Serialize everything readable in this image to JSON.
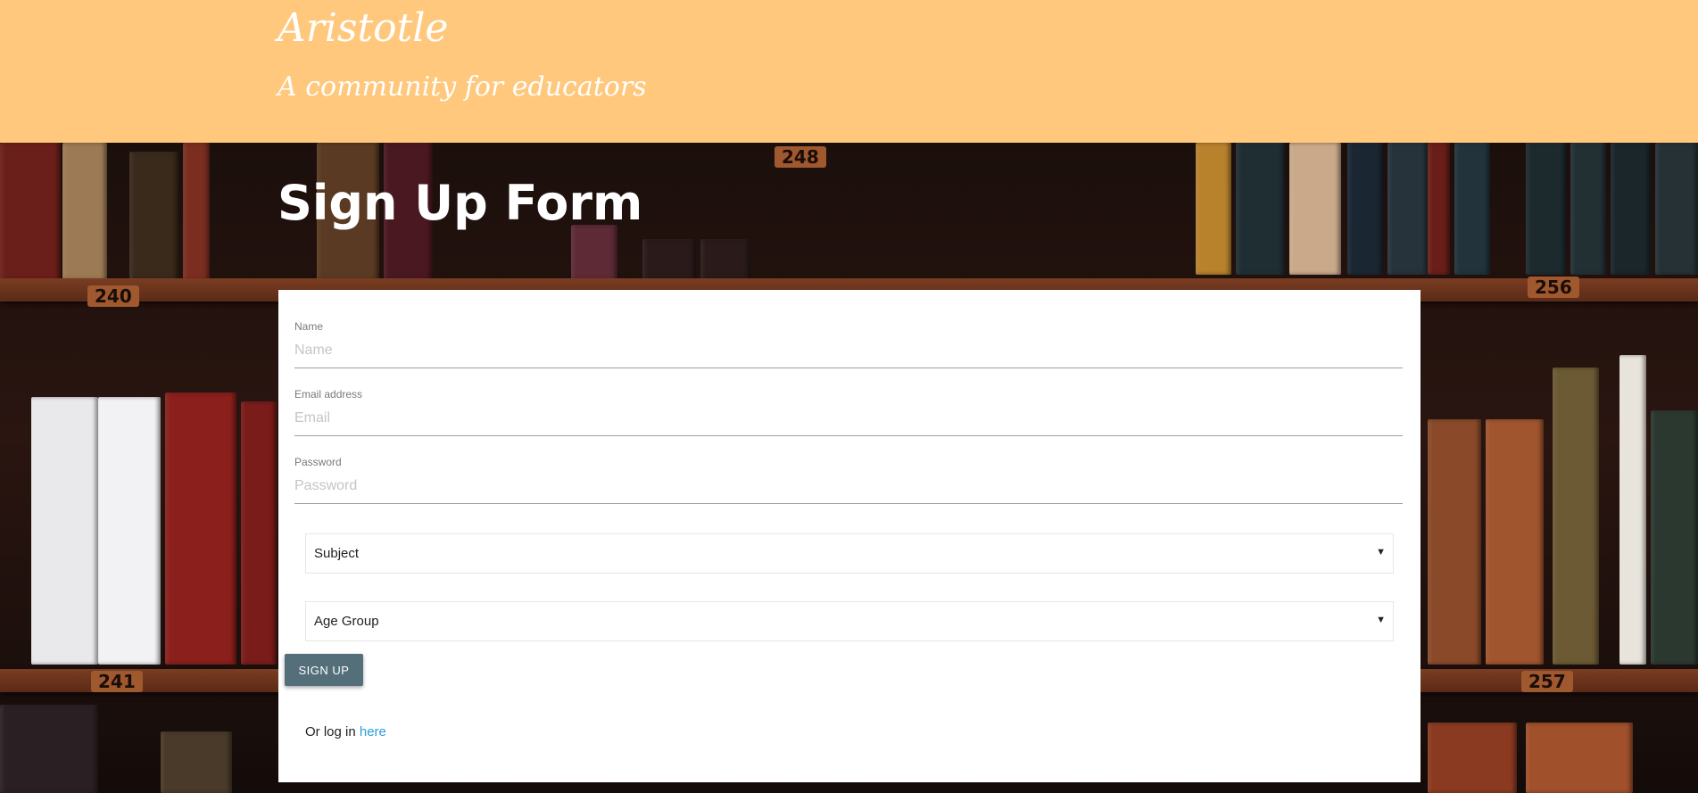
{
  "header": {
    "title": "Aristotle",
    "subtitle": "A community for educators"
  },
  "backdrop": {
    "shelf_numbers": [
      "248",
      "240",
      "256",
      "241",
      "257"
    ],
    "description_hidden": ""
  },
  "page": {
    "heading": "Sign Up Form"
  },
  "form": {
    "name": {
      "label": "Name",
      "placeholder": "Name",
      "value": ""
    },
    "email": {
      "label": "Email address",
      "placeholder": "Email",
      "value": ""
    },
    "password": {
      "label": "Password",
      "placeholder": "Password",
      "value": ""
    },
    "subject": {
      "selected": "Subject"
    },
    "age_group": {
      "selected": "Age Group"
    },
    "submit_label": "SIGN UP",
    "login_prefix": "Or log in ",
    "login_link": "here"
  },
  "colors": {
    "header_bg": "#ffc87c",
    "button_bg": "#546e7a",
    "link": "#2a9fd6"
  }
}
